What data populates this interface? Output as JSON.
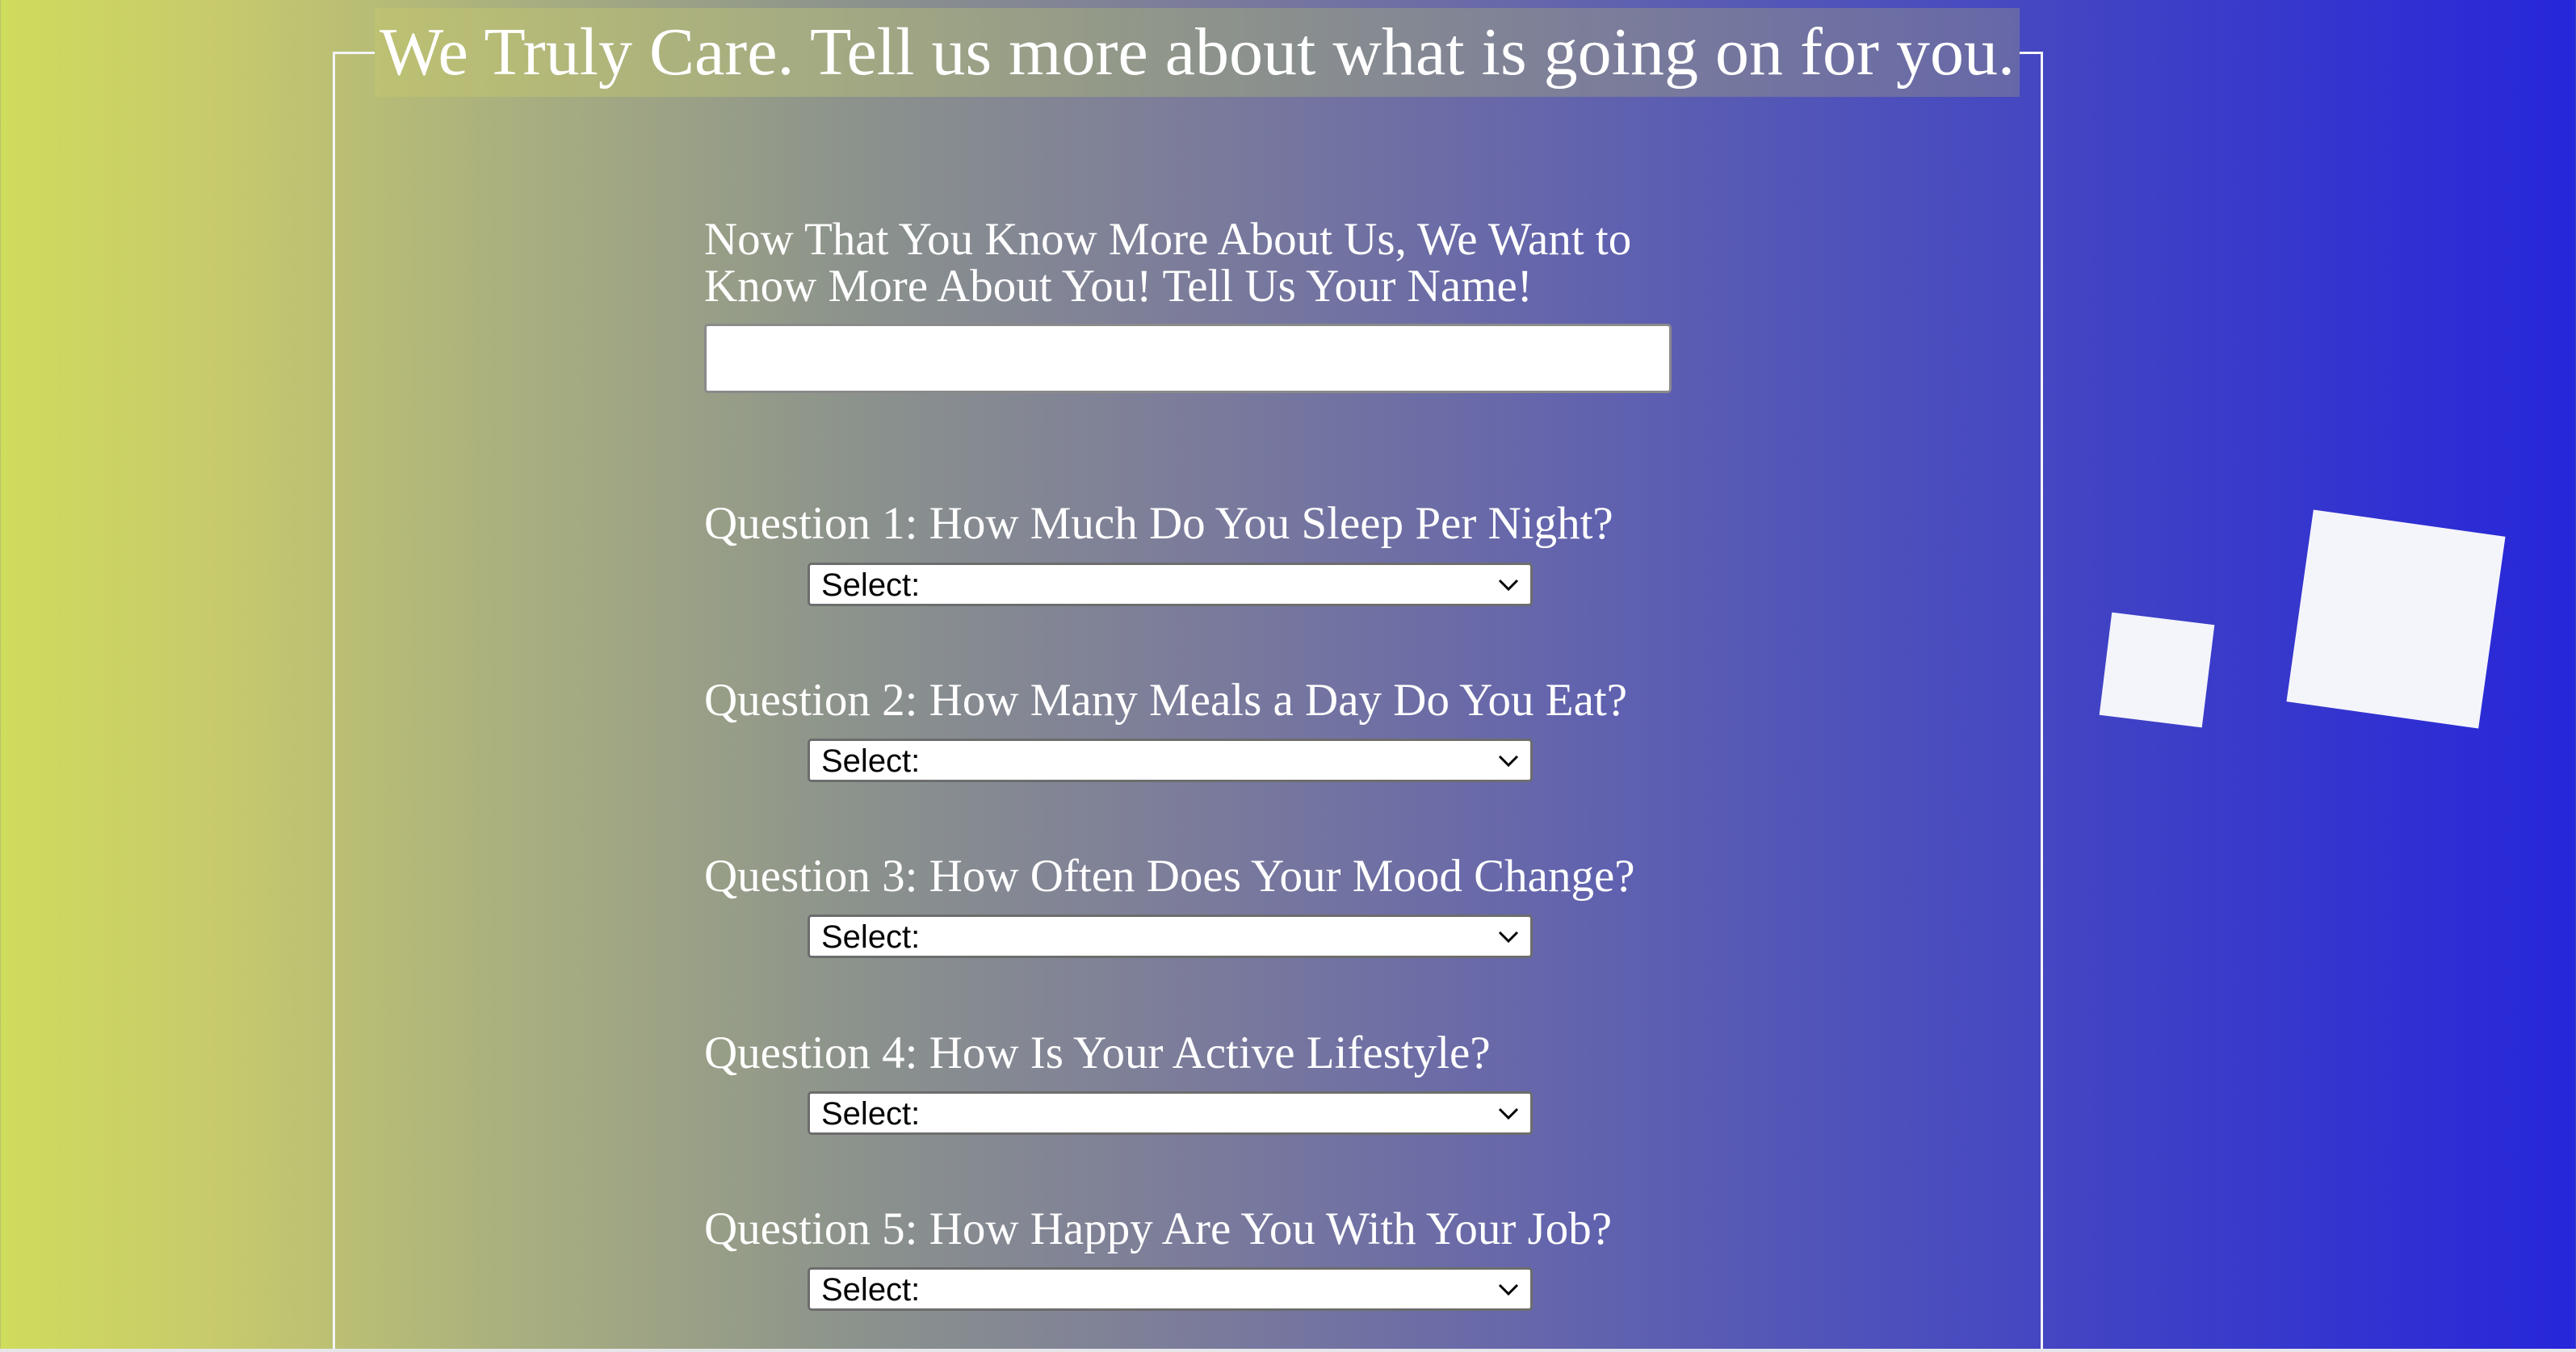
{
  "legend": "We Truly Care. Tell us more about what is going on for you.",
  "name_prompt": {
    "line1": "Now That You Know More About Us, We Want to",
    "line2": "Know More About You! Tell Us Your Name!",
    "value": ""
  },
  "questions": [
    {
      "label": "Question 1: How Much Do You Sleep Per Night?",
      "selected": "Select:"
    },
    {
      "label": "Question 2: How Many Meals a Day Do You Eat?",
      "selected": "Select:"
    },
    {
      "label": "Question 3: How Often Does Your Mood Change?",
      "selected": "Select:"
    },
    {
      "label": "Question 4: How Is Your Active Lifestyle?",
      "selected": "Select:"
    },
    {
      "label": "Question 5: How Happy Are You With Your Job?",
      "selected": "Select:"
    }
  ],
  "icons": {
    "select_indicator": "chevron-down-icon",
    "decorations": [
      "small-square-shape",
      "large-square-shape"
    ]
  },
  "colors": {
    "gradient_start": "#cfdc5c",
    "gradient_end": "#2626da",
    "text": "#ffffff",
    "decoration": "#f4f4fb"
  }
}
